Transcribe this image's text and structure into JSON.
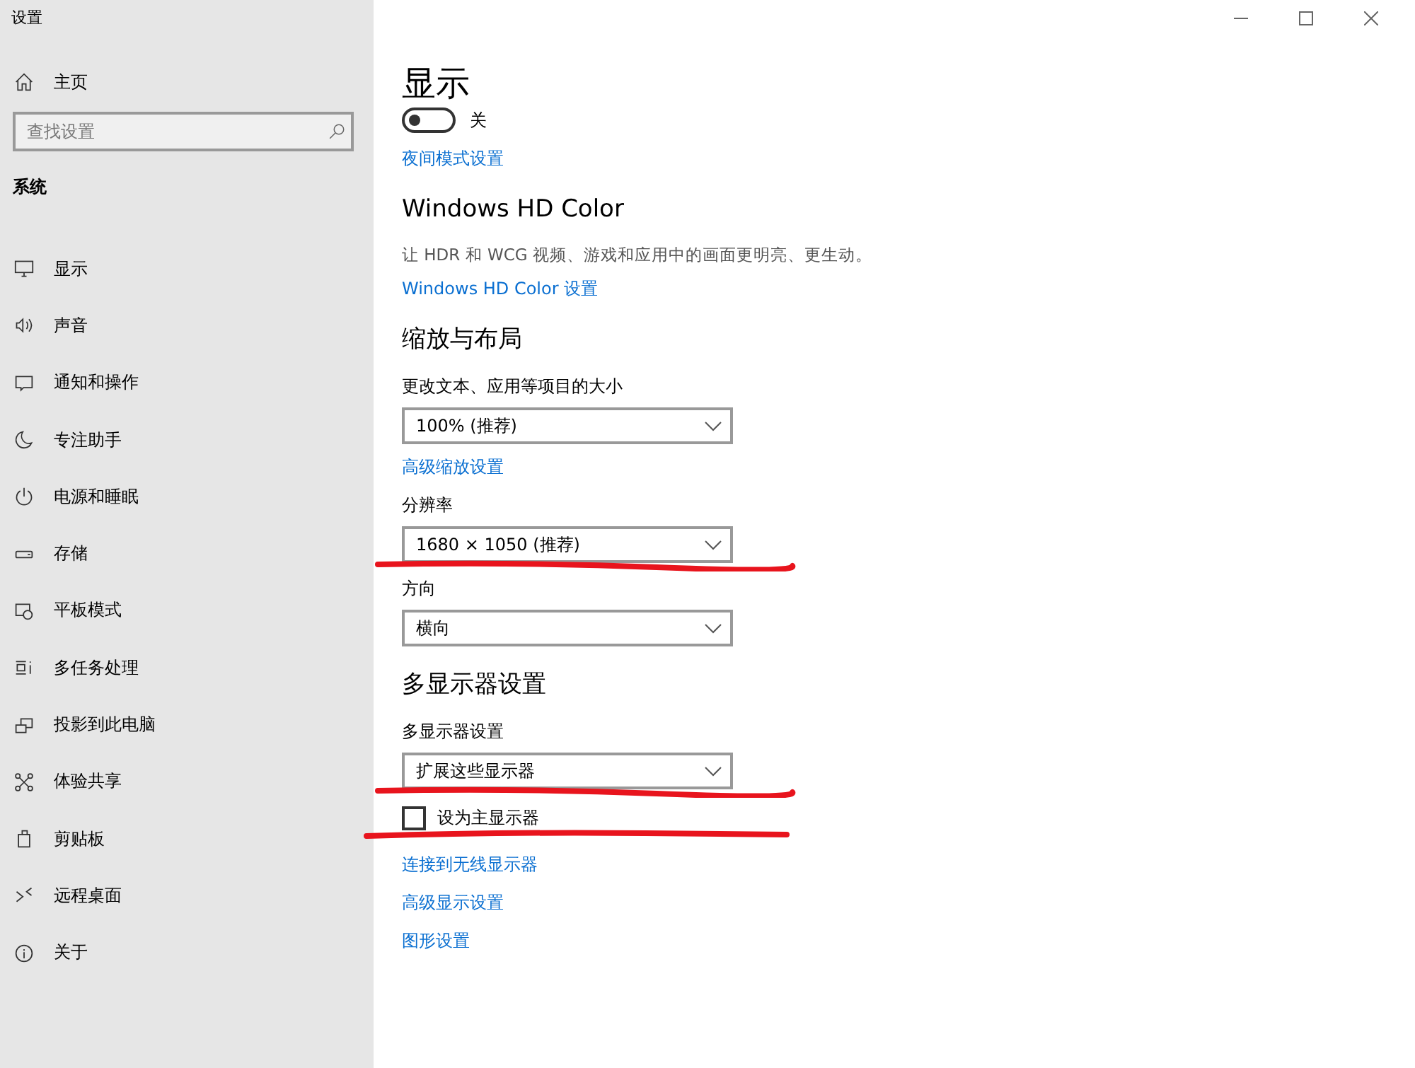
{
  "window": {
    "title": "设置"
  },
  "sidebar": {
    "home": "主页",
    "search": {
      "placeholder": "查找设置"
    },
    "section": "系统",
    "items": [
      {
        "label": "显示"
      },
      {
        "label": "声音"
      },
      {
        "label": "通知和操作"
      },
      {
        "label": "专注助手"
      },
      {
        "label": "电源和睡眠"
      },
      {
        "label": "存储"
      },
      {
        "label": "平板模式"
      },
      {
        "label": "多任务处理"
      },
      {
        "label": "投影到此电脑"
      },
      {
        "label": "体验共享"
      },
      {
        "label": "剪贴板"
      },
      {
        "label": "远程桌面"
      },
      {
        "label": "关于"
      }
    ]
  },
  "main": {
    "title": "显示",
    "items": [
      {
        "kind": "toggle",
        "on": false,
        "label": "关"
      },
      {
        "kind": "link",
        "text": "夜间模式设置"
      },
      {
        "kind": "heading",
        "text": "Windows HD Color"
      },
      {
        "kind": "description",
        "text": "让 HDR 和 WCG 视频、游戏和应用中的画面更明亮、更生动。"
      },
      {
        "kind": "link",
        "text": "Windows HD Color 设置"
      },
      {
        "kind": "heading",
        "text": "缩放与布局"
      },
      {
        "kind": "label",
        "text": "更改文本、应用等项目的大小"
      },
      {
        "kind": "dropdown",
        "value": "100% (推荐)",
        "underlined": false
      },
      {
        "kind": "link",
        "text": "高级缩放设置"
      },
      {
        "kind": "label",
        "text": "分辨率"
      },
      {
        "kind": "dropdown",
        "value": "1680 × 1050 (推荐)",
        "underlined": true
      },
      {
        "kind": "label",
        "text": "方向"
      },
      {
        "kind": "dropdown",
        "value": "横向",
        "underlined": false
      },
      {
        "kind": "heading",
        "text": "多显示器设置"
      },
      {
        "kind": "label",
        "text": "多显示器设置"
      },
      {
        "kind": "dropdown",
        "value": "扩展这些显示器",
        "underlined": true
      },
      {
        "kind": "checkbox",
        "checked": false,
        "text": "设为主显示器",
        "underlined": true
      },
      {
        "kind": "link",
        "text": "连接到无线显示器"
      },
      {
        "kind": "link",
        "text": "高级显示设置"
      },
      {
        "kind": "link",
        "text": "图形设置"
      }
    ]
  }
}
